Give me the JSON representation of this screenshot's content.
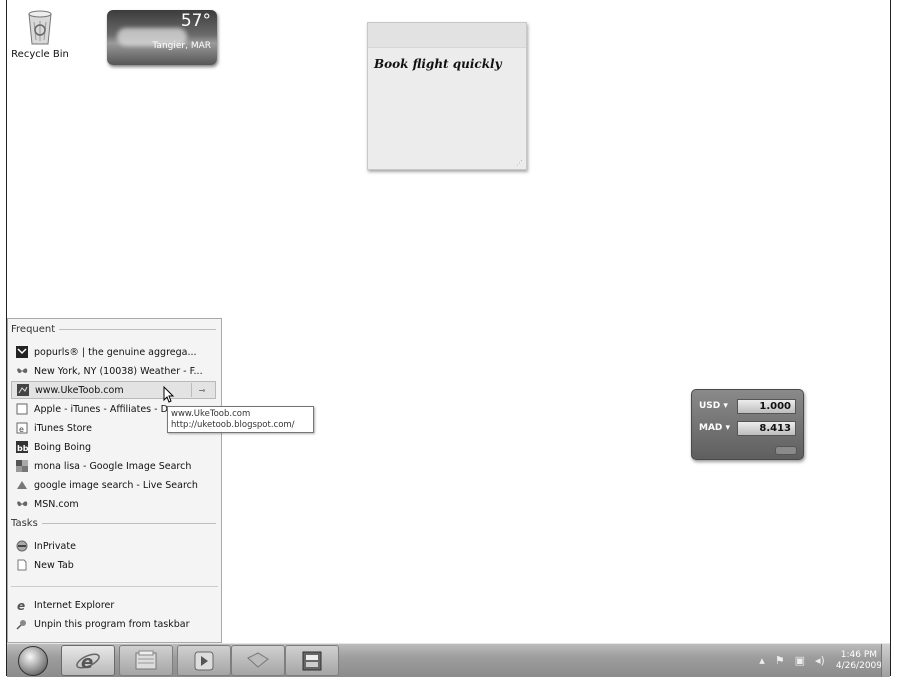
{
  "desktop": {
    "recycle_bin_label": "Recycle Bin"
  },
  "weather_gadget": {
    "temperature": "57°",
    "location": "Tangier, MAR"
  },
  "sticky_note": {
    "text": "Book flight quickly"
  },
  "jump_list": {
    "frequent_header": "Frequent",
    "frequent_items": [
      {
        "label": "popurls® | the genuine aggrega...",
        "icon": "popurls-icon"
      },
      {
        "label": "New York, NY (10038) Weather - F...",
        "icon": "msn-butterfly-icon"
      },
      {
        "label": "www.UkeToob.com",
        "icon": "uketoob-icon"
      },
      {
        "label": "Apple - iTunes - Affiliates - Do",
        "icon": "page-icon"
      },
      {
        "label": "iTunes Store",
        "icon": "ie-page-icon"
      },
      {
        "label": "Boing Boing",
        "icon": "boingboing-icon"
      },
      {
        "label": "mona lisa - Google Image Search",
        "icon": "google-icon"
      },
      {
        "label": "google image search - Live Search",
        "icon": "live-search-icon"
      },
      {
        "label": "MSN.com",
        "icon": "msn-butterfly-icon"
      }
    ],
    "pin_glyph": "⊸",
    "tasks_header": "Tasks",
    "task_items": [
      {
        "label": "InPrivate",
        "icon": "inprivate-icon"
      },
      {
        "label": "New Tab",
        "icon": "new-tab-icon"
      }
    ],
    "bottom_items": [
      {
        "label": "Internet Explorer",
        "icon": "internet-explorer-icon"
      },
      {
        "label": "Unpin this program from taskbar",
        "icon": "unpin-icon"
      }
    ],
    "tooltip": {
      "title": "www.UkeToob.com",
      "url": "http://uketoob.blogspot.com/"
    }
  },
  "currency_gadget": {
    "from_currency": "USD",
    "from_value": "1.000",
    "to_currency": "MAD",
    "to_value": "8.413"
  },
  "taskbar": {
    "buttons": [
      "start-orb",
      "internet-explorer",
      "windows-explorer",
      "media-player",
      "gadget",
      "film-strip"
    ],
    "tray_time": "1:46 PM",
    "tray_date": "4/26/2009"
  }
}
